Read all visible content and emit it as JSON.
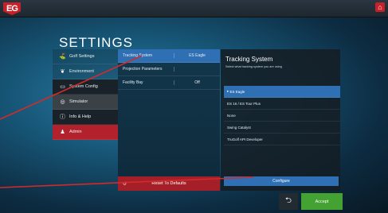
{
  "app": {
    "logo_text": "EG",
    "home_icon": "home-icon",
    "title": "SETTINGS"
  },
  "sidebar": {
    "items": [
      {
        "label": "Golf Settings",
        "icon": "flag-icon",
        "glyph": "⛳"
      },
      {
        "label": "Environment",
        "icon": "plant-icon",
        "glyph": "❦"
      },
      {
        "label": "System Config",
        "icon": "monitor-icon",
        "glyph": "▭"
      },
      {
        "label": "Simulator",
        "icon": "target-icon",
        "glyph": "◎"
      },
      {
        "label": "Info & Help",
        "icon": "info-icon",
        "glyph": "ⓘ"
      },
      {
        "label": "Admin",
        "icon": "user-icon",
        "glyph": "♟"
      }
    ]
  },
  "simulator_menu": {
    "rows": [
      {
        "label": "Tracking System",
        "value": "ES Eagle"
      },
      {
        "label": "Projection Parameters",
        "value": ""
      },
      {
        "label": "Facility Bay",
        "value": "Off"
      }
    ],
    "reset_label": "Reset To Defaults"
  },
  "tracking_panel": {
    "title": "Tracking System",
    "description": "Select what tracking system you are using",
    "options": [
      "ES Eagle",
      "ES 16 / ES Tour Plus",
      "None",
      "Swing Catalyst",
      "TruGolf API Developer"
    ],
    "selected": "ES Eagle",
    "configure_label": "Configure"
  },
  "footer": {
    "back_icon": "back-icon",
    "back_glyph": "⮌",
    "accept_label": "Accept"
  },
  "colors": {
    "accent_red": "#c62128",
    "accent_blue": "#2f6fb4",
    "accept_green": "#43a231"
  }
}
